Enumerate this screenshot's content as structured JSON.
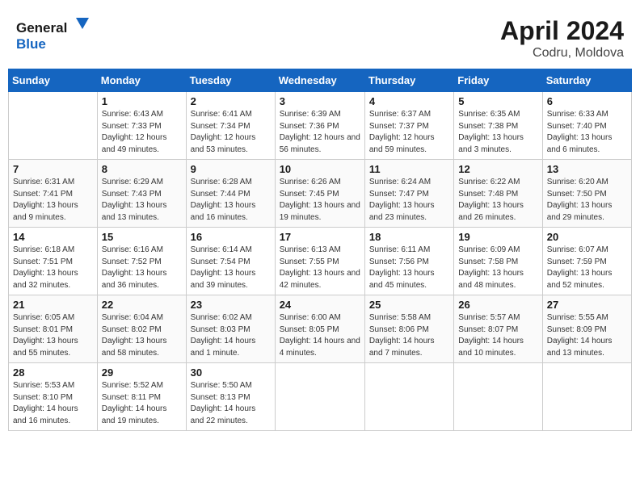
{
  "header": {
    "logo_text_general": "General",
    "logo_text_blue": "Blue",
    "title": "April 2024",
    "subtitle": "Codru, Moldova"
  },
  "weekdays": [
    "Sunday",
    "Monday",
    "Tuesday",
    "Wednesday",
    "Thursday",
    "Friday",
    "Saturday"
  ],
  "weeks": [
    [
      null,
      {
        "day": 1,
        "sunrise": "6:43 AM",
        "sunset": "7:33 PM",
        "daylight": "12 hours and 49 minutes."
      },
      {
        "day": 2,
        "sunrise": "6:41 AM",
        "sunset": "7:34 PM",
        "daylight": "12 hours and 53 minutes."
      },
      {
        "day": 3,
        "sunrise": "6:39 AM",
        "sunset": "7:36 PM",
        "daylight": "12 hours and 56 minutes."
      },
      {
        "day": 4,
        "sunrise": "6:37 AM",
        "sunset": "7:37 PM",
        "daylight": "12 hours and 59 minutes."
      },
      {
        "day": 5,
        "sunrise": "6:35 AM",
        "sunset": "7:38 PM",
        "daylight": "13 hours and 3 minutes."
      },
      {
        "day": 6,
        "sunrise": "6:33 AM",
        "sunset": "7:40 PM",
        "daylight": "13 hours and 6 minutes."
      }
    ],
    [
      {
        "day": 7,
        "sunrise": "6:31 AM",
        "sunset": "7:41 PM",
        "daylight": "13 hours and 9 minutes."
      },
      {
        "day": 8,
        "sunrise": "6:29 AM",
        "sunset": "7:43 PM",
        "daylight": "13 hours and 13 minutes."
      },
      {
        "day": 9,
        "sunrise": "6:28 AM",
        "sunset": "7:44 PM",
        "daylight": "13 hours and 16 minutes."
      },
      {
        "day": 10,
        "sunrise": "6:26 AM",
        "sunset": "7:45 PM",
        "daylight": "13 hours and 19 minutes."
      },
      {
        "day": 11,
        "sunrise": "6:24 AM",
        "sunset": "7:47 PM",
        "daylight": "13 hours and 23 minutes."
      },
      {
        "day": 12,
        "sunrise": "6:22 AM",
        "sunset": "7:48 PM",
        "daylight": "13 hours and 26 minutes."
      },
      {
        "day": 13,
        "sunrise": "6:20 AM",
        "sunset": "7:50 PM",
        "daylight": "13 hours and 29 minutes."
      }
    ],
    [
      {
        "day": 14,
        "sunrise": "6:18 AM",
        "sunset": "7:51 PM",
        "daylight": "13 hours and 32 minutes."
      },
      {
        "day": 15,
        "sunrise": "6:16 AM",
        "sunset": "7:52 PM",
        "daylight": "13 hours and 36 minutes."
      },
      {
        "day": 16,
        "sunrise": "6:14 AM",
        "sunset": "7:54 PM",
        "daylight": "13 hours and 39 minutes."
      },
      {
        "day": 17,
        "sunrise": "6:13 AM",
        "sunset": "7:55 PM",
        "daylight": "13 hours and 42 minutes."
      },
      {
        "day": 18,
        "sunrise": "6:11 AM",
        "sunset": "7:56 PM",
        "daylight": "13 hours and 45 minutes."
      },
      {
        "day": 19,
        "sunrise": "6:09 AM",
        "sunset": "7:58 PM",
        "daylight": "13 hours and 48 minutes."
      },
      {
        "day": 20,
        "sunrise": "6:07 AM",
        "sunset": "7:59 PM",
        "daylight": "13 hours and 52 minutes."
      }
    ],
    [
      {
        "day": 21,
        "sunrise": "6:05 AM",
        "sunset": "8:01 PM",
        "daylight": "13 hours and 55 minutes."
      },
      {
        "day": 22,
        "sunrise": "6:04 AM",
        "sunset": "8:02 PM",
        "daylight": "13 hours and 58 minutes."
      },
      {
        "day": 23,
        "sunrise": "6:02 AM",
        "sunset": "8:03 PM",
        "daylight": "14 hours and 1 minute."
      },
      {
        "day": 24,
        "sunrise": "6:00 AM",
        "sunset": "8:05 PM",
        "daylight": "14 hours and 4 minutes."
      },
      {
        "day": 25,
        "sunrise": "5:58 AM",
        "sunset": "8:06 PM",
        "daylight": "14 hours and 7 minutes."
      },
      {
        "day": 26,
        "sunrise": "5:57 AM",
        "sunset": "8:07 PM",
        "daylight": "14 hours and 10 minutes."
      },
      {
        "day": 27,
        "sunrise": "5:55 AM",
        "sunset": "8:09 PM",
        "daylight": "14 hours and 13 minutes."
      }
    ],
    [
      {
        "day": 28,
        "sunrise": "5:53 AM",
        "sunset": "8:10 PM",
        "daylight": "14 hours and 16 minutes."
      },
      {
        "day": 29,
        "sunrise": "5:52 AM",
        "sunset": "8:11 PM",
        "daylight": "14 hours and 19 minutes."
      },
      {
        "day": 30,
        "sunrise": "5:50 AM",
        "sunset": "8:13 PM",
        "daylight": "14 hours and 22 minutes."
      },
      null,
      null,
      null,
      null
    ]
  ],
  "labels": {
    "sunrise": "Sunrise:",
    "sunset": "Sunset:",
    "daylight": "Daylight:"
  }
}
